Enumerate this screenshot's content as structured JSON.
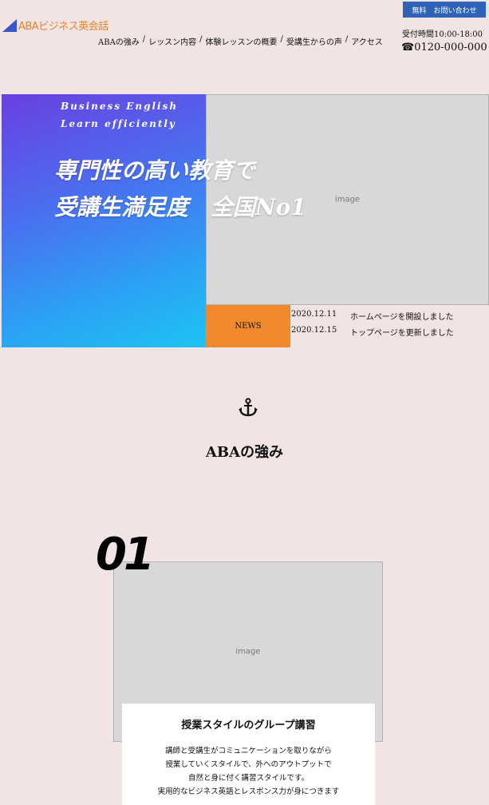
{
  "header": {
    "logo_text": "ABAビジネス英会話",
    "contact_button": "無料　お問い合わせ",
    "hours": "受付時間10:00-18:00",
    "phone": "☎0120-000-000",
    "nav": [
      "ABAの強み",
      "レッスン内容",
      "体験レッスンの概要",
      "受講生からの声",
      "アクセス"
    ]
  },
  "hero": {
    "tag1": "Business English",
    "tag2": "Learn efficiently",
    "headline1": "専門性の高い教育で",
    "headline2": "受講生満足度　全国No1",
    "news_label": "NEWS",
    "news": [
      {
        "date": "2020.12.11",
        "text": "ホームページを開設しました"
      },
      {
        "date": "2020.12.15",
        "text": "トップページを更新しました"
      }
    ]
  },
  "strengths": {
    "title": "ABAの強み",
    "number": "01",
    "feature_title": "授業スタイルのグループ講習",
    "feature_body": [
      "講師と受講生がコミュニケーションを取りながら",
      "授業していくスタイルで、外へのアウトプットで",
      "自然と身に付く講習スタイルです。",
      "実用的なビジネス英語とレスポンス力が身につきます"
    ]
  },
  "colors": {
    "background": "#f2e4e4",
    "accent_blue": "#2f63b7",
    "news_orange": "#f08a2c",
    "logo_orange": "#e6832a"
  }
}
